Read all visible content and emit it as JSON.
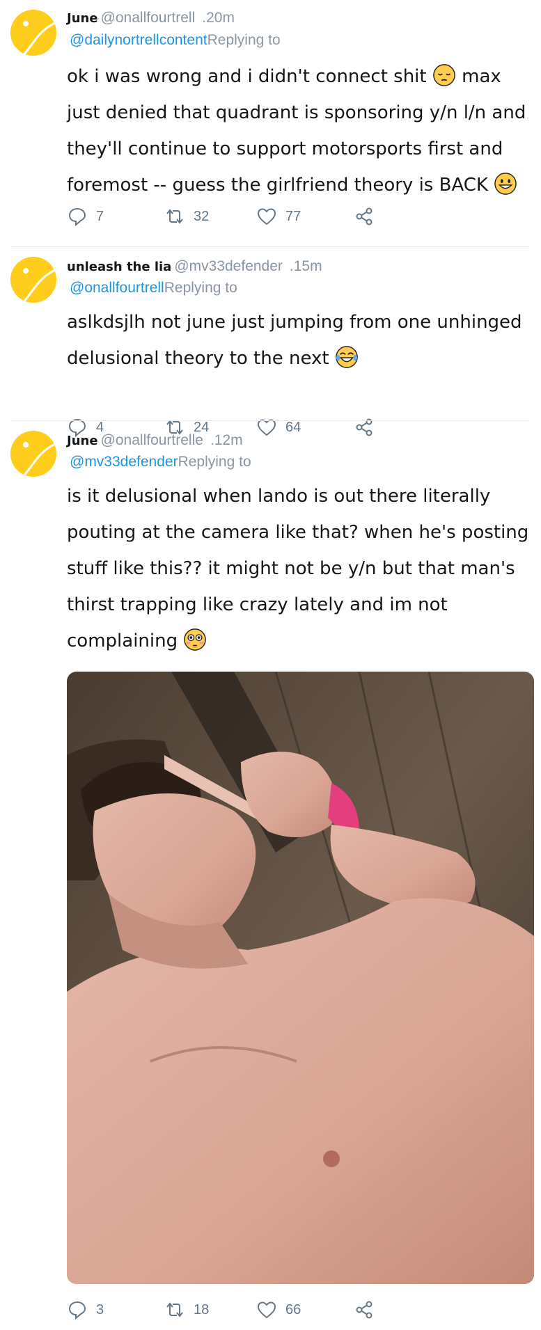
{
  "tweets": [
    {
      "name": "June",
      "handle": "@onallfourtrell",
      "time": ".20m",
      "mention": "@dailynortrellcontent",
      "replying": "Replying to",
      "text_1": "ok i was wrong and i didn't connect shit ",
      "text_2": " max just denied that quadrant is sponsoring y/n l/n and they'll continue to support motorsports first and foremost -- guess the girlfriend theory is BACK ",
      "emoji_1": "pensive-face-emoji",
      "emoji_2": "grinning-face-emoji",
      "replies": "7",
      "retweets": "32",
      "likes": "77"
    },
    {
      "name": "unleash the lia",
      "handle": "@mv33defender",
      "time": ".15m",
      "mention": "@onallfourtrell",
      "replying": "Replying to",
      "text_1": "aslkdsjlh not june just jumping from one unhinged delusional theory to the next ",
      "emoji_1": "tears-of-joy-emoji",
      "replies": "4",
      "retweets": "24",
      "likes": "64"
    },
    {
      "name": "June",
      "handle": "@onallfourtrelle",
      "time": ".12m",
      "mention": "@mv33defender",
      "replying": "Replying to",
      "text_1": "is it delusional when lando is out there literally pouting at the camera like that? when he's posting stuff like this?? it might not be y/n but that man's thirst trapping like crazy lately and im not complaining ",
      "emoji_1": "flushed-face-emoji",
      "replies": "3",
      "retweets": "18",
      "likes": "66"
    }
  ],
  "colors": {
    "avatar": "#ffcd1c",
    "link": "#1b95e0",
    "meta": "#8a96a3",
    "icon": "#657786"
  },
  "icons": [
    "reply-icon",
    "retweet-icon",
    "like-icon",
    "share-icon"
  ]
}
